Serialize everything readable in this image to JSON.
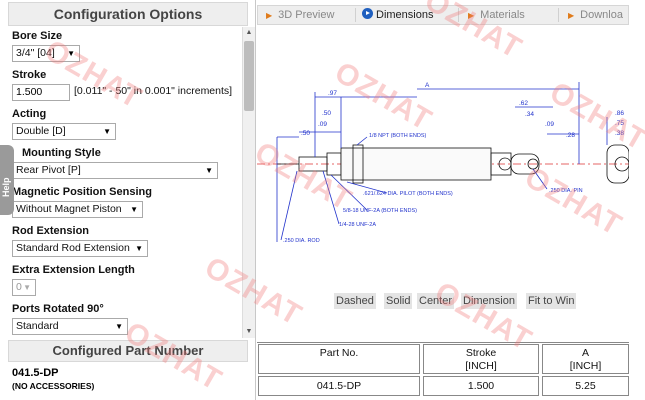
{
  "left_panel": {
    "title": "Configuration Options",
    "options": [
      {
        "label": "Bore Size",
        "value": "3/4\" [04]"
      },
      {
        "label": "Stroke",
        "value": "1.500",
        "hint": "[0.011\" - 50\" in 0.001\" increments]"
      },
      {
        "label": "Acting",
        "value": "Double [D]"
      },
      {
        "label": "Mounting Style",
        "value": "Rear Pivot [P]"
      },
      {
        "label": "Magnetic Position Sensing",
        "value": "Without Magnet Piston"
      },
      {
        "label": "Rod Extension",
        "value": "Standard Rod Extension"
      },
      {
        "label": "Extra Extension Length",
        "value": "0"
      },
      {
        "label": "Ports Rotated 90°",
        "value": "Standard"
      }
    ],
    "help_tab": "Help",
    "configured_title": "Configured Part Number",
    "part_number": "041.5-DP",
    "accessories": "(NO ACCESSORIES)"
  },
  "tabs": [
    {
      "label": "3D Preview",
      "active": false
    },
    {
      "label": "Dimensions",
      "active": true
    },
    {
      "label": "Materials",
      "active": false
    },
    {
      "label": "Downloa",
      "active": false
    }
  ],
  "drawing": {
    "dims_top": [
      ".97",
      ".50",
      ".09",
      "A",
      ".62",
      ".34",
      ".09",
      ".86",
      ".75",
      ".38"
    ],
    "dims_left": [
      ".50",
      ".28"
    ],
    "callouts": [
      "1/8 NPT (BOTH ENDS)",
      ".621/.624 DIA. PILOT (BOTH ENDS)",
      "5/8-18 UNF-2A (BOTH ENDS)",
      "1/4-28 UNF-2A",
      ".250 DIA. ROD",
      ".250 DIA. PIN"
    ]
  },
  "view_buttons": [
    "Dashed",
    "Solid",
    "Center",
    "Dimension",
    "Fit to Win"
  ],
  "table": {
    "headers": [
      {
        "line1": "Part No.",
        "line2": ""
      },
      {
        "line1": "Stroke",
        "line2": "[INCH]"
      },
      {
        "line1": "A",
        "line2": "[INCH]"
      }
    ],
    "row": [
      "041.5-DP",
      "1.500",
      "5.25"
    ]
  },
  "watermark": "OZHAT",
  "colors": {
    "accent": "#1f5fbf",
    "tab_arrow": "#e07b1a",
    "watermark": "#f07878",
    "drawing": "#2233cc"
  }
}
